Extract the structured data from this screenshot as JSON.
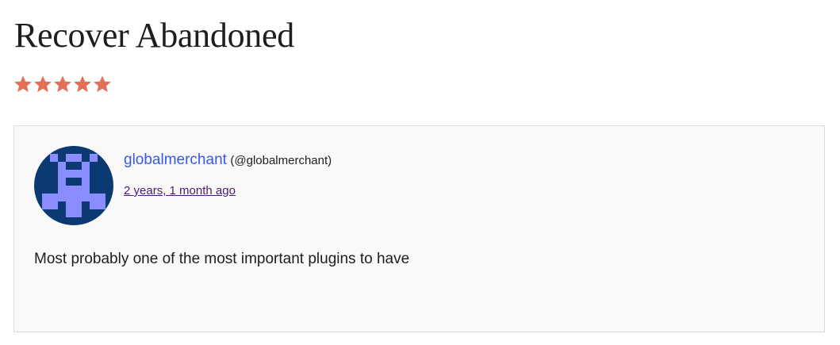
{
  "review": {
    "title": "Recover Abandoned",
    "rating": {
      "value": 5,
      "max": 5,
      "color": "#e26f56"
    },
    "author": {
      "name": "globalmerchant",
      "handle": "(@globalmerchant)",
      "avatar_icon": "pixel-avatar-icon",
      "avatar_colors": {
        "background": "#0b3a72",
        "pixels": "#8a8cff"
      }
    },
    "date": "2 years, 1 month ago",
    "body": "Most probably one of the most important plugins to have"
  }
}
